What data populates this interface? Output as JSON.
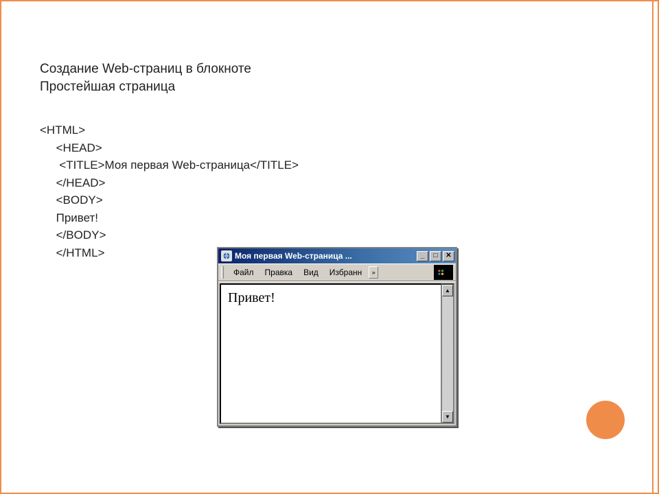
{
  "slide": {
    "heading_line1": "Создание Web-страниц в блокноте",
    "heading_line2": "Простейшая страница",
    "code": "<HTML>\n     <HEAD>\n      <TITLE>Моя первая Web-страница</TITLE>\n     </HEAD>\n     <BODY>\n     Привет!\n     </BODY>\n     </HTML>"
  },
  "browser": {
    "title": "Моя первая Web-страница ...",
    "menu": {
      "file": "Файл",
      "edit": "Правка",
      "view": "Вид",
      "favorites": "Избранн",
      "overflow": "»"
    },
    "window_controls": {
      "minimize": "_",
      "maximize": "□",
      "close": "✕"
    },
    "content": "Привет!",
    "scrollbar": {
      "up": "▲",
      "down": "▼"
    }
  }
}
